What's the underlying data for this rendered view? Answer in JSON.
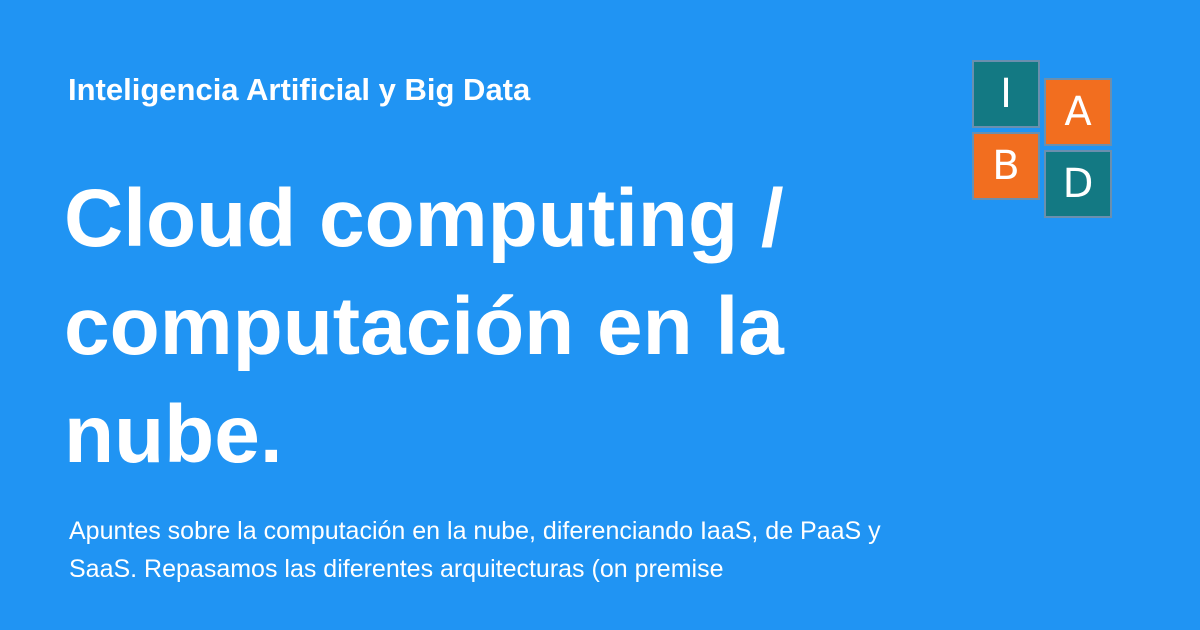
{
  "header": {
    "site_name": "Inteligencia Artificial y Big Data"
  },
  "main": {
    "title": "Cloud computing / computación en la nube.",
    "description": "Apuntes sobre la computación en la nube, diferenciando IaaS, de PaaS y SaaS. Repasamos las diferentes arquitecturas (on premise"
  },
  "logo": {
    "letters": [
      "I",
      "A",
      "B",
      "D"
    ]
  },
  "colors": {
    "background": "#2094f3",
    "logo_teal": "#137983",
    "logo_orange": "#f26e1f",
    "text": "#ffffff"
  }
}
